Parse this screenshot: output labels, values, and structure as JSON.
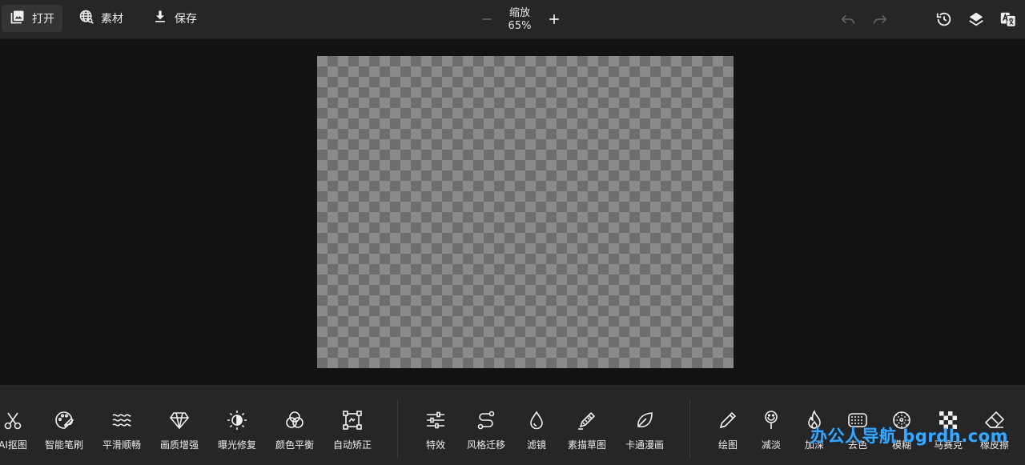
{
  "topbar": {
    "open_label": "打开",
    "assets_label": "素材",
    "save_label": "保存",
    "zoom_title": "缩放",
    "zoom_value": "65%"
  },
  "toolbar": {
    "group1": [
      {
        "label": "AI抠图",
        "icon": "scissors-icon"
      },
      {
        "label": "智能笔刷",
        "icon": "palette-icon"
      },
      {
        "label": "平滑顺畅",
        "icon": "waves-icon"
      },
      {
        "label": "画质增强",
        "icon": "diamond-icon"
      },
      {
        "label": "曝光修复",
        "icon": "exposure-icon"
      },
      {
        "label": "颜色平衡",
        "icon": "color-circles-icon"
      },
      {
        "label": "自动矫正",
        "icon": "crop-frame-icon"
      }
    ],
    "group2": [
      {
        "label": "特效",
        "icon": "sliders-icon"
      },
      {
        "label": "风格迁移",
        "icon": "style-transfer-icon"
      },
      {
        "label": "滤镜",
        "icon": "drop-icon"
      },
      {
        "label": "素描草图",
        "icon": "pencil-sketch-icon"
      },
      {
        "label": "卡通漫画",
        "icon": "leaf-icon"
      }
    ],
    "group3": [
      {
        "label": "绘图",
        "icon": "pencil-icon"
      },
      {
        "label": "减淡",
        "icon": "dodge-icon"
      },
      {
        "label": "加深",
        "icon": "flame-icon"
      },
      {
        "label": "去色",
        "icon": "desaturate-icon"
      },
      {
        "label": "模糊",
        "icon": "blur-icon"
      },
      {
        "label": "马赛克",
        "icon": "mosaic-icon"
      },
      {
        "label": "橡皮擦",
        "icon": "eraser-icon"
      }
    ]
  },
  "watermark": "办公人导航 bgrdh.com"
}
